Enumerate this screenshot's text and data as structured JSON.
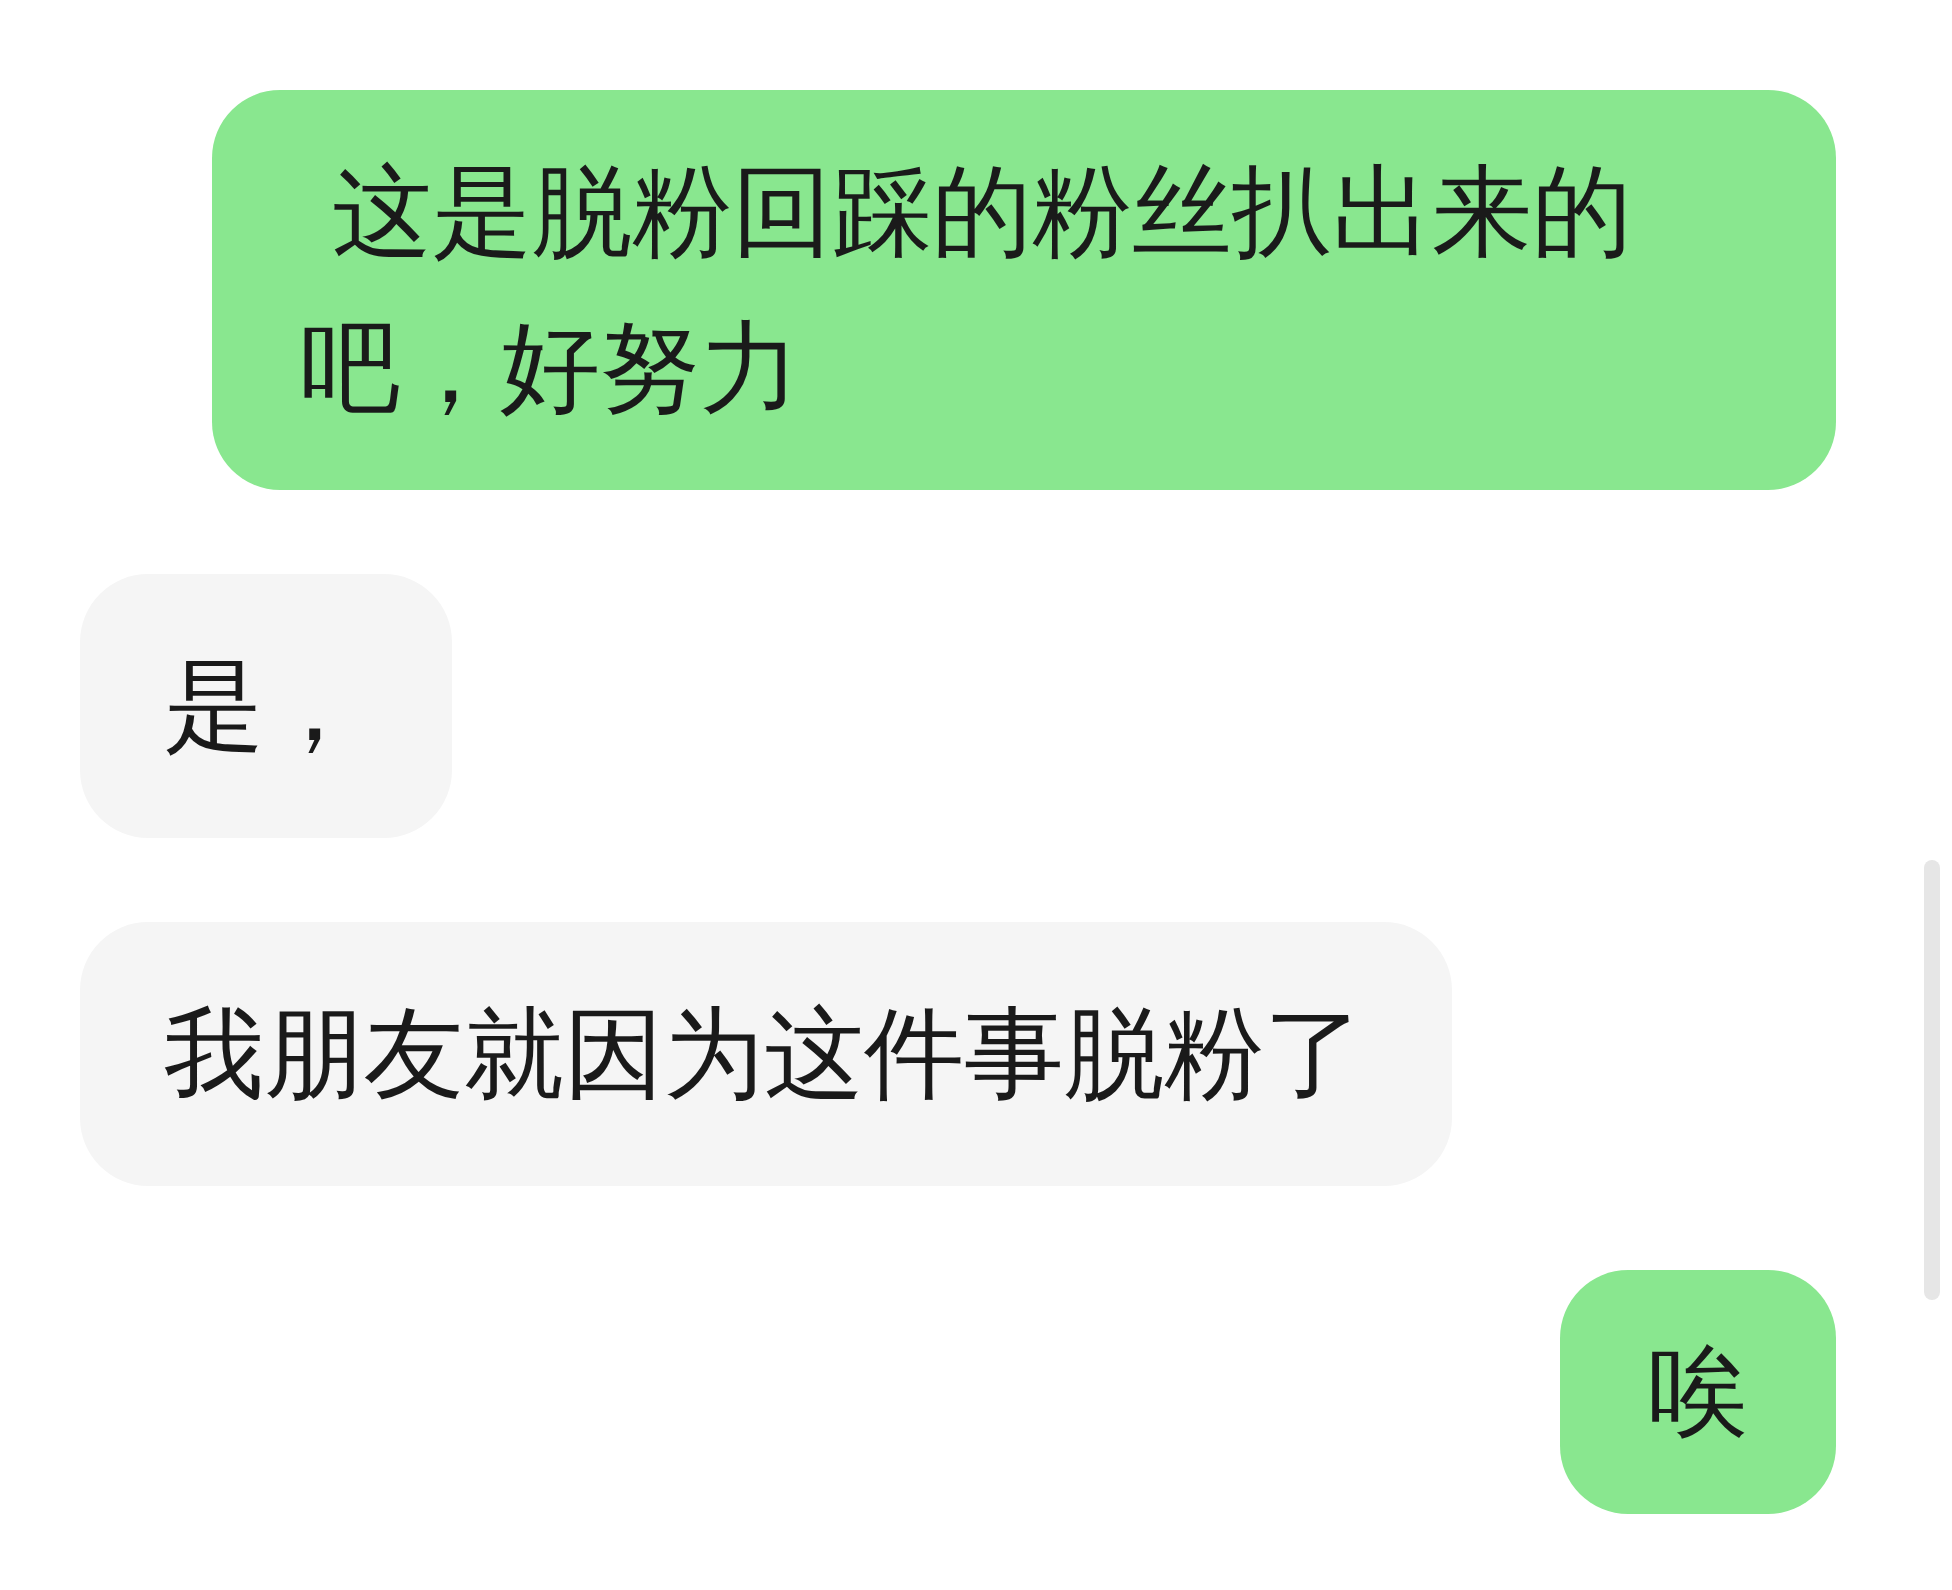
{
  "messages": [
    {
      "kind": "outgoing",
      "text": " 这是脱粉回踩的粉丝扒出来的吧，好努力"
    },
    {
      "kind": "incoming",
      "text": "是，"
    },
    {
      "kind": "incoming",
      "text": "我朋友就因为这件事脱粉了"
    },
    {
      "kind": "outgoing",
      "text": "唉"
    }
  ]
}
